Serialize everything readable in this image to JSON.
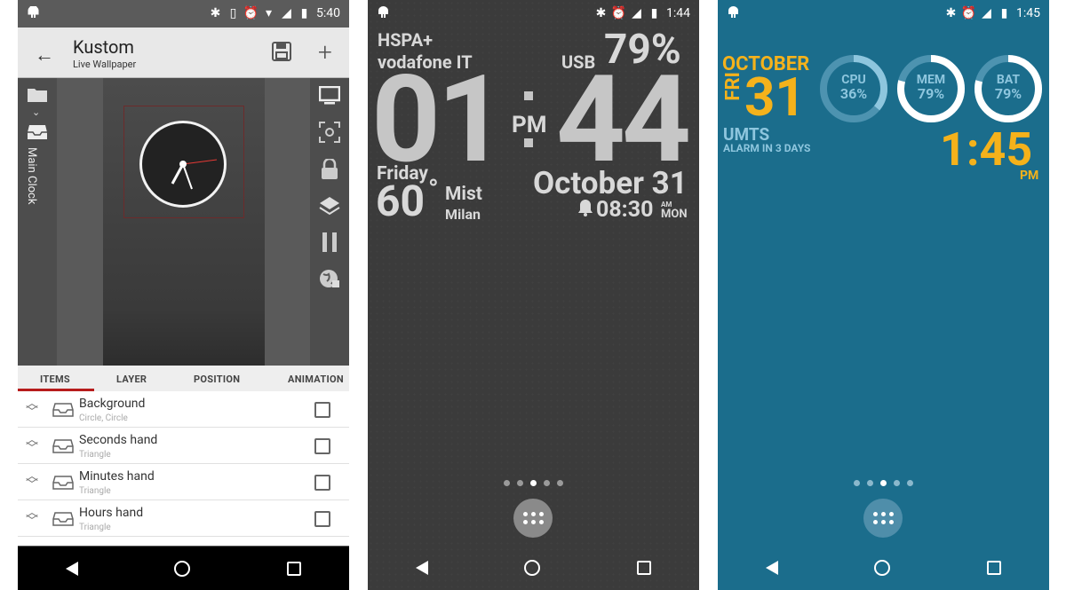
{
  "phone1": {
    "status": {
      "time": "5:40"
    },
    "app": {
      "title": "Kustom",
      "subtitle": "Live Wallpaper"
    },
    "sidebar_label": "Main Clock",
    "tabs": [
      "ITEMS",
      "LAYER",
      "POSITION",
      "ANIMATION"
    ],
    "items": [
      {
        "name": "Background",
        "sub": "Circle, Circle"
      },
      {
        "name": "Seconds hand",
        "sub": "Triangle"
      },
      {
        "name": "Minutes hand",
        "sub": "Triangle"
      },
      {
        "name": "Hours hand",
        "sub": "Triangle"
      }
    ]
  },
  "phone2": {
    "status": {
      "time": "1:44"
    },
    "network": "HSPA+",
    "carrier": "vodafone IT",
    "battery_label": "USB",
    "battery_pct": "79%",
    "hour": "01",
    "minute": "44",
    "ampm": "PM",
    "day": "Friday",
    "temp": "60",
    "degree": "°",
    "weather": "Mist",
    "city": "Milan",
    "date": "October 31",
    "alarm_time": "08:30",
    "alarm_ampm": "AM",
    "alarm_day": "MON"
  },
  "phone3": {
    "status": {
      "time": "1:45"
    },
    "month": "OCTOBER",
    "weekday": "FRI",
    "daynum": "31",
    "network": "UMTS",
    "alarm": "ALARM IN 3 DAYS",
    "time": "1:45",
    "ampm": "PM",
    "rings": [
      {
        "label": "CPU",
        "value": "36%",
        "fraction": 0.36
      },
      {
        "label": "MEM",
        "value": "79%",
        "fraction": 0.79
      },
      {
        "label": "BAT",
        "value": "79%",
        "fraction": 0.79
      }
    ]
  },
  "colors": {
    "accent_red": "#b71c1c",
    "phone3_bg": "#1b6d8c",
    "phone3_yellow": "#f5b21b",
    "phone3_blue": "#8ec6de"
  }
}
